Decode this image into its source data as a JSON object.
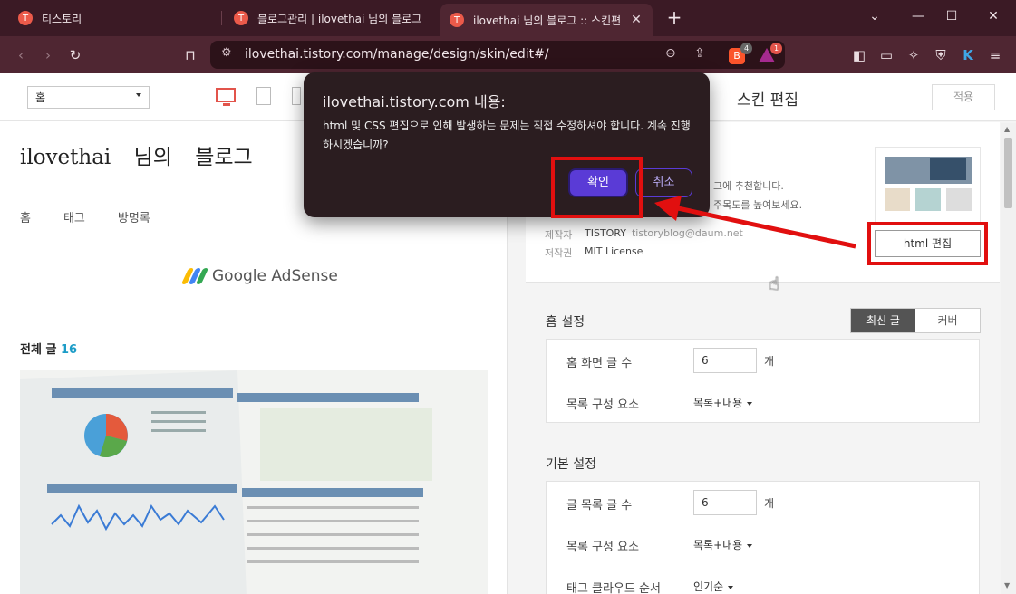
{
  "browser": {
    "tabs": [
      {
        "title": "티스토리",
        "active": false
      },
      {
        "title": "블로그관리 | ilovethai 님의 블로그",
        "active": false
      },
      {
        "title": "ilovethai 님의 블로그 :: 스킨편",
        "active": true
      }
    ],
    "new_tab": "+",
    "url": "ilovethai.tistory.com/manage/design/skin/edit#/",
    "shields_count": "4",
    "rewards_count": "1"
  },
  "preview": {
    "page_select": "홈",
    "blog_title": "ilovethai 님의 블로그",
    "nav": [
      "홈",
      "태그",
      "방명록"
    ],
    "adsense_label": "Google AdSense",
    "all_posts_label": "전체 글",
    "all_posts_count": "16"
  },
  "editor": {
    "title": "스킨 편집",
    "apply_label": "적용",
    "skin_desc_line1": "그에 추천합니다.",
    "skin_desc_line2": "주목도를 높여보세요.",
    "author_key": "제작자",
    "author_value": "TISTORY",
    "author_email": "tistoryblog@daum.net",
    "license_key": "저작권",
    "license_value": "MIT License",
    "html_edit_label": "html 편집",
    "home_settings": {
      "title": "홈 설정",
      "seg_latest": "최신 글",
      "seg_cover": "커버",
      "rows": [
        {
          "label": "홈 화면 글 수",
          "value": "6",
          "unit": "개"
        },
        {
          "label": "목록 구성 요소",
          "value": "목록+내용"
        }
      ]
    },
    "basic_settings": {
      "title": "기본 설정",
      "rows": [
        {
          "label": "글 목록 글 수",
          "value": "6",
          "unit": "개"
        },
        {
          "label": "목록 구성 요소",
          "value": "목록+내용"
        },
        {
          "label": "태그 클라우드 순서",
          "value": "인기순"
        }
      ]
    }
  },
  "dialog": {
    "title": "ilovethai.tistory.com 내용:",
    "message": "html 및 CSS 편집으로 인해 발생하는 문제는 직접 수정하셔야 합니다. 계속 진행하시겠습니까?",
    "ok_label": "확인",
    "cancel_label": "취소"
  },
  "colors": {
    "highlight_red": "#e10f0f",
    "dialog_accent": "#5a3bd6",
    "tab_bar": "#3b1a25",
    "toolbar": "#4f2632"
  }
}
